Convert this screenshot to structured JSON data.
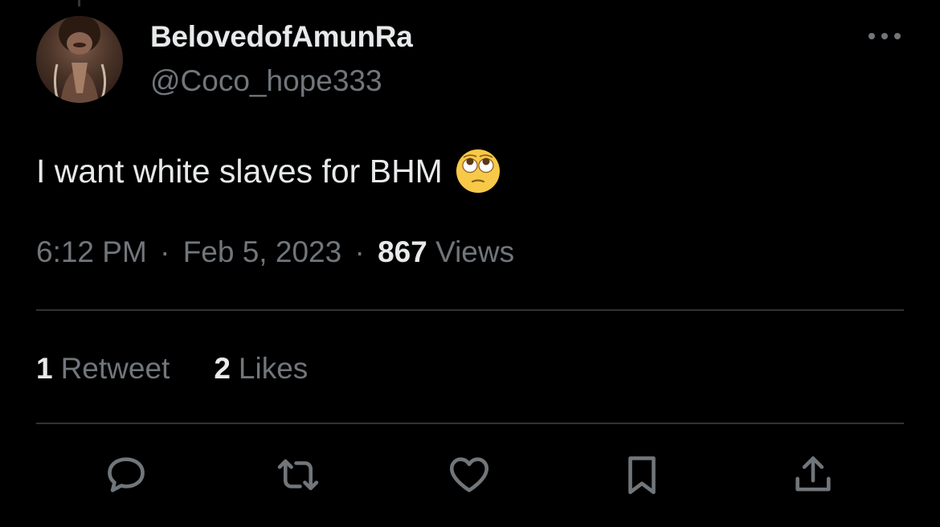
{
  "user": {
    "display_name": "BelovedofAmunRa",
    "handle": "@Coco_hope333"
  },
  "tweet": {
    "text": "I want white slaves for BHM",
    "emoji": "face-with-rolling-eyes-emoji"
  },
  "meta": {
    "time": "6:12 PM",
    "separator": "·",
    "date": "Feb 5, 2023",
    "views_count": "867",
    "views_label": "Views"
  },
  "stats": {
    "retweets_count": "1",
    "retweets_label": "Retweet",
    "likes_count": "2",
    "likes_label": "Likes"
  },
  "icons": {
    "more": "more-horizontal-icon",
    "reply": "reply-icon",
    "retweet": "retweet-icon",
    "like": "heart-icon",
    "bookmark": "bookmark-icon",
    "share": "share-icon"
  },
  "colors": {
    "background": "#000000",
    "primary_text": "#e7e9ea",
    "secondary_text": "#71767b",
    "divider": "#2f3336"
  }
}
